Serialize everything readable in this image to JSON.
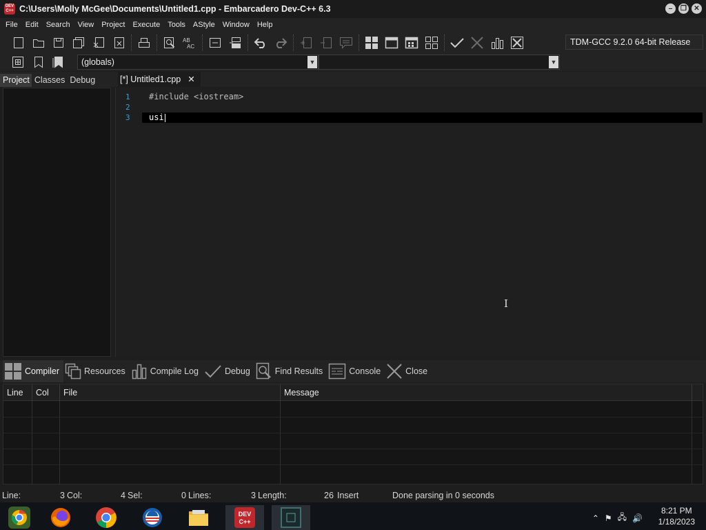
{
  "window": {
    "title": "C:\\Users\\Molly McGee\\Documents\\Untitled1.cpp - Embarcadero Dev-C++ 6.3",
    "app_icon_text": "DEV C++",
    "controls": [
      "minimize-icon",
      "restore-icon",
      "close-icon"
    ]
  },
  "menu": [
    "File",
    "Edit",
    "Search",
    "View",
    "Project",
    "Execute",
    "Tools",
    "AStyle",
    "Window",
    "Help"
  ],
  "toolbar": {
    "compiler": "TDM-GCC 9.2.0 64-bit Release",
    "scope": "(globals)",
    "members": ""
  },
  "left_panel": {
    "tabs": [
      "Project",
      "Classes",
      "Debug"
    ],
    "active_tab": "Project"
  },
  "editor": {
    "tab_label": "[*] Untitled1.cpp",
    "lines": [
      {
        "num": "1",
        "text": "#include <iostream>"
      },
      {
        "num": "2",
        "text": ""
      },
      {
        "num": "3",
        "text": "usi"
      }
    ]
  },
  "bottom_tabs": [
    {
      "label": "Compiler",
      "icon": "grid-icon"
    },
    {
      "label": "Resources",
      "icon": "resources-icon"
    },
    {
      "label": "Compile Log",
      "icon": "bar-chart-icon"
    },
    {
      "label": "Debug",
      "icon": "check-icon"
    },
    {
      "label": "Find Results",
      "icon": "find-icon"
    },
    {
      "label": "Console",
      "icon": "console-icon"
    },
    {
      "label": "Close",
      "icon": "close-x-icon"
    }
  ],
  "results": {
    "columns": [
      "Line",
      "Col",
      "File",
      "Message"
    ]
  },
  "status": {
    "line_label": "Line:",
    "line_value": "3",
    "col_label": "Col:",
    "col_value": "4",
    "sel_label": "Sel:",
    "sel_value": "0",
    "lines_label": "Lines:",
    "lines_value": "3",
    "length_label": "Length:",
    "length_value": "26",
    "mode": "Insert",
    "message": "Done parsing in 0 seconds"
  },
  "taskbar": {
    "apps": [
      "chrome-canary-icon",
      "firefox-icon",
      "chrome-icon",
      "app-circle-icon",
      "file-explorer-icon",
      "devcpp-icon",
      "terminal-icon"
    ],
    "devcpp_label": "DEV C++",
    "time": "8:21 PM",
    "date": "1/18/2023",
    "accent": "#c0272d"
  }
}
